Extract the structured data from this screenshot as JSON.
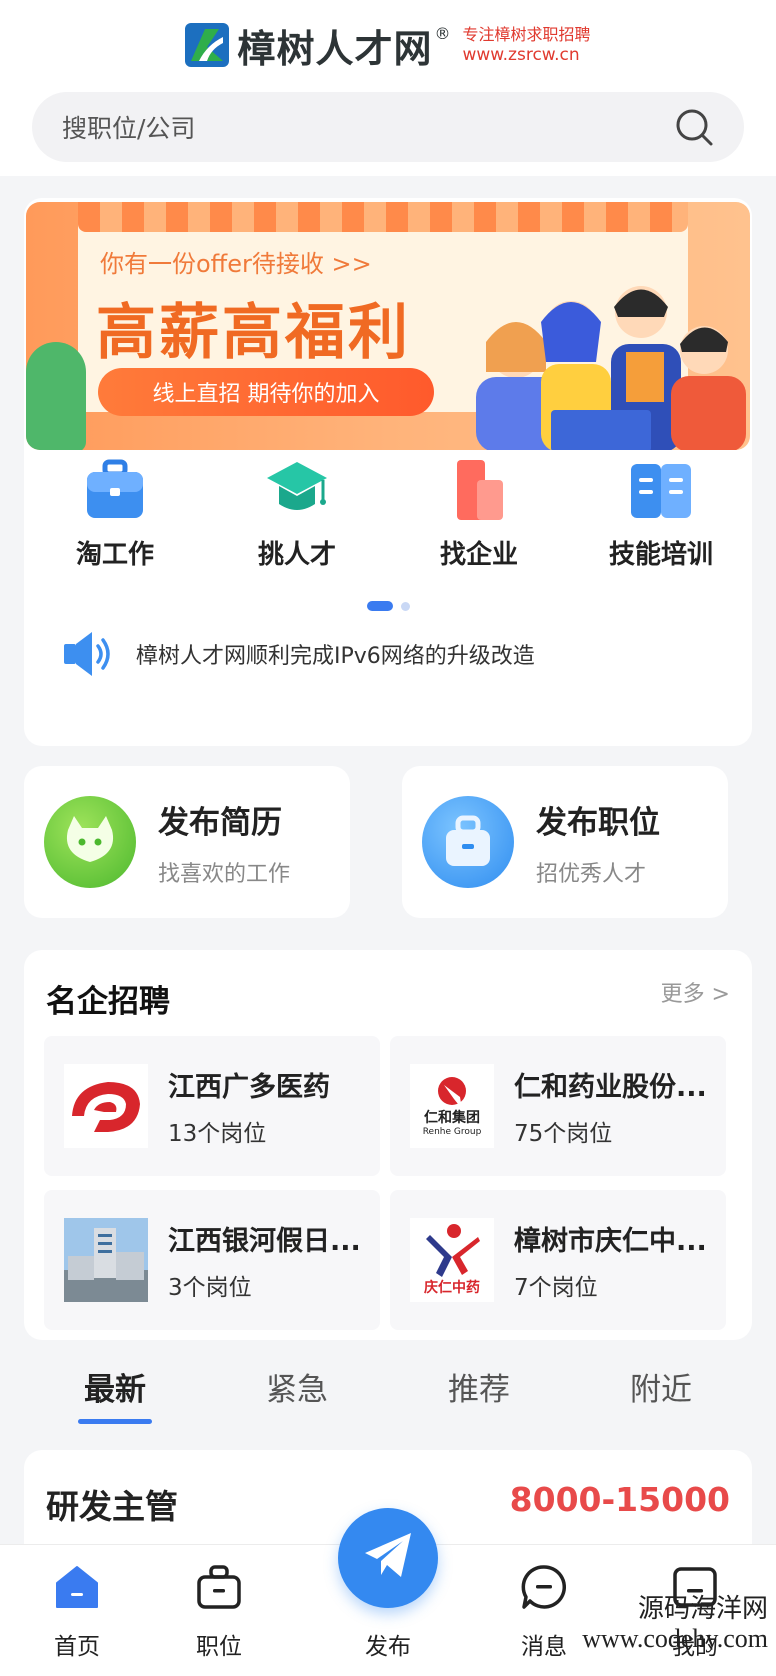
{
  "header": {
    "logo_name": "樟树人才网",
    "logo_registered": "®",
    "logo_slogan": "专注樟树求职招聘",
    "logo_url": "www.zsrcw.cn",
    "search_placeholder": "搜职位/公司"
  },
  "banner": {
    "subtitle": "你有一份offer待接收 >>",
    "title": "高薪高福利",
    "pill": "线上直招 期待你的加入"
  },
  "quick_nav": [
    {
      "label": "淘工作",
      "icon": "briefcase-icon"
    },
    {
      "label": "挑人才",
      "icon": "graduation-cap-icon"
    },
    {
      "label": "找企业",
      "icon": "building-icon"
    },
    {
      "label": "技能培训",
      "icon": "book-icon"
    }
  ],
  "carousel": {
    "pages": 2,
    "active": 1
  },
  "notice": {
    "text": "樟树人才网顺利完成IPv6网络的升级改造",
    "icon": "speaker-icon"
  },
  "publish": {
    "resume": {
      "title": "发布简历",
      "subtitle": "找喜欢的工作"
    },
    "job": {
      "title": "发布职位",
      "subtitle": "招优秀人才"
    }
  },
  "companies": {
    "title": "名企招聘",
    "more": "更多 >",
    "items": [
      {
        "name": "江西广多医药",
        "jobs": "13个岗位"
      },
      {
        "name": "仁和药业股份...",
        "jobs": "75个岗位",
        "logo_text": "仁和集团",
        "logo_sub": "Renhe Group"
      },
      {
        "name": "江西银河假日...",
        "jobs": "3个岗位"
      },
      {
        "name": "樟树市庆仁中...",
        "jobs": "7个岗位",
        "logo_text": "庆仁中药"
      }
    ]
  },
  "job_tabs": [
    "最新",
    "紧急",
    "推荐",
    "附近"
  ],
  "job_tabs_active": "最新",
  "job": {
    "title": "研发主管",
    "salary": "8000-15000"
  },
  "bottom_nav": [
    {
      "label": "首页",
      "icon": "home-icon"
    },
    {
      "label": "职位",
      "icon": "job-bag-icon"
    },
    {
      "label": "发布",
      "icon": "paper-plane-icon"
    },
    {
      "label": "消息",
      "icon": "message-icon"
    },
    {
      "label": "我的",
      "icon": "profile-icon"
    }
  ],
  "watermark": {
    "line1": "源码海洋网",
    "line2": "www.codehy.com"
  },
  "colors": {
    "accent": "#3a7bf0",
    "salary": "#e84a4a",
    "brand_red": "#e03a2f"
  }
}
